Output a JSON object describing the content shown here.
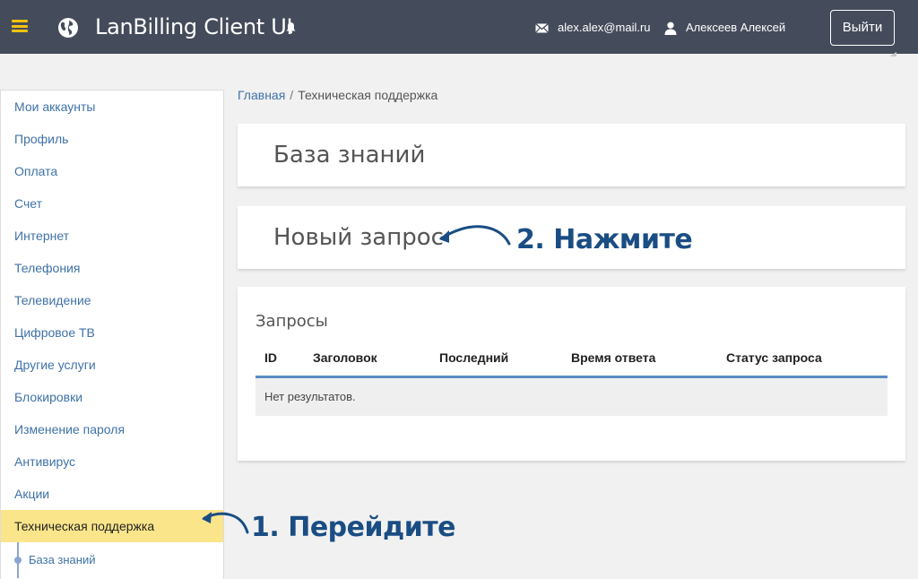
{
  "header": {
    "app_title": "LanBilling Client UI",
    "email": "alex.alex@mail.ru",
    "user_name": "Алексеев Алексей",
    "logout_label": "Выйти"
  },
  "colors": {
    "header_bg": "#444c5b",
    "accent_yellow": "#fbe58b",
    "link_blue": "#3f72a8",
    "annotation_blue": "#1a4d83"
  },
  "sidebar": {
    "items": [
      {
        "label": "Мои аккаунты"
      },
      {
        "label": "Профиль"
      },
      {
        "label": "Оплата"
      },
      {
        "label": "Счет"
      },
      {
        "label": "Интернет"
      },
      {
        "label": "Телефония"
      },
      {
        "label": "Телевидение"
      },
      {
        "label": "Цифровое ТВ"
      },
      {
        "label": "Другие услуги"
      },
      {
        "label": "Блокировки"
      },
      {
        "label": "Изменение пароля"
      },
      {
        "label": "Антивирус"
      },
      {
        "label": "Акции"
      },
      {
        "label": "Техническая поддержка",
        "active": true
      }
    ],
    "sub_item": "База знаний"
  },
  "breadcrumb": {
    "home": "Главная",
    "separator": "/",
    "current": "Техническая поддержка"
  },
  "main": {
    "knowledge_base": "База знаний",
    "new_request": "Новый запрос",
    "requests_title": "Запросы",
    "columns": [
      "ID",
      "Заголовок",
      "Последний",
      "Время ответа",
      "Статус запроса"
    ],
    "empty_text": "Нет результатов."
  },
  "annotations": {
    "step1": "1. Перейдите",
    "step2": "2. Нажмите"
  }
}
